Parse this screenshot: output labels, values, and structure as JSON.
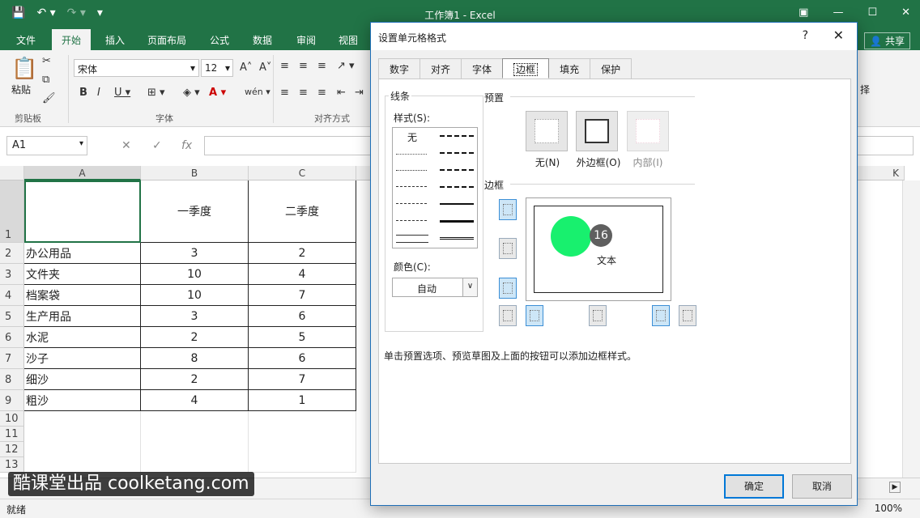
{
  "window": {
    "title": "工作簿1 - Excel"
  },
  "menu": {
    "tabs": [
      "文件",
      "开始",
      "插入",
      "页面布局",
      "公式",
      "数据",
      "审阅",
      "视图"
    ],
    "active": "开始",
    "share": "共享"
  },
  "ribbon": {
    "paste_label": "粘贴",
    "font_name": "宋体",
    "font_size": "12",
    "groups": {
      "clipboard": "剪贴板",
      "font": "字体",
      "alignment": "对齐方式"
    },
    "right_partial": "择"
  },
  "formula": {
    "namebox": "A1",
    "fx": "fx"
  },
  "sheet": {
    "columns": [
      "A",
      "B",
      "C"
    ],
    "col_k": "K",
    "header_row": {
      "b": "一季度",
      "c": "二季度"
    },
    "rows": [
      {
        "num": "2",
        "a": "办公用品",
        "b": "3",
        "c": "2"
      },
      {
        "num": "3",
        "a": "文件夹",
        "b": "10",
        "c": "4"
      },
      {
        "num": "4",
        "a": "档案袋",
        "b": "10",
        "c": "7"
      },
      {
        "num": "5",
        "a": "生产用品",
        "b": "3",
        "c": "6"
      },
      {
        "num": "6",
        "a": "水泥",
        "b": "2",
        "c": "5"
      },
      {
        "num": "7",
        "a": "沙子",
        "b": "8",
        "c": "6"
      },
      {
        "num": "8",
        "a": "细沙",
        "b": "2",
        "c": "7"
      },
      {
        "num": "9",
        "a": "粗沙",
        "b": "4",
        "c": "1"
      }
    ],
    "row1": "1",
    "empty_rows": [
      "10",
      "11",
      "12",
      "13"
    ]
  },
  "watermark": "酷课堂出品 coolketang.com",
  "status": {
    "ready": "就绪",
    "zoom": "100%"
  },
  "dialog": {
    "title": "设置单元格格式",
    "help": "?",
    "close": "✕",
    "tabs": [
      "数字",
      "对齐",
      "字体",
      "边框",
      "填充",
      "保护"
    ],
    "active_tab": "边框",
    "line_section": "线条",
    "style_label": "样式(S):",
    "style_none": "无",
    "color_label": "颜色(C):",
    "color_value": "自动",
    "preset_section": "预置",
    "presets": [
      "无(N)",
      "外边框(O)",
      "内部(I)"
    ],
    "border_section": "边框",
    "preview_text": "文本",
    "badge": "16",
    "hint": "单击预置选项、预览草图及上面的按钮可以添加边框样式。",
    "ok": "确定",
    "cancel": "取消"
  }
}
